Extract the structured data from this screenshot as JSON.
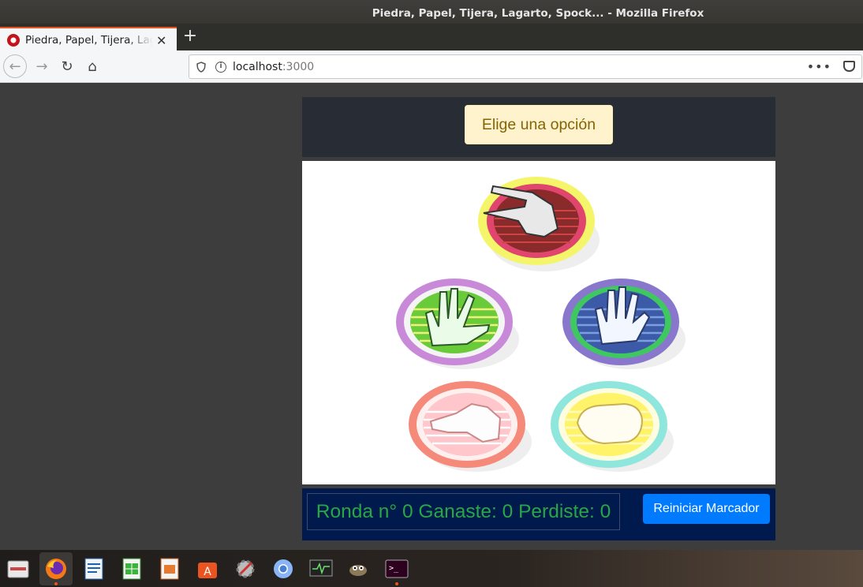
{
  "window": {
    "title": "Piedra, Papel, Tijera, Lagarto, Spock... - Mozilla Firefox"
  },
  "tab": {
    "title": "Piedra, Papel, Tijera, Lagarto, Spock...",
    "close": "✕",
    "new_tab": "+"
  },
  "navbar": {
    "back": "←",
    "forward": "→",
    "reload": "↻",
    "home": "⌂",
    "url_host": "localhost",
    "url_port": ":3000",
    "info_glyph": "i",
    "more_glyph": "•••"
  },
  "app": {
    "choose_label": "Elige una opción",
    "options": [
      "Tijera",
      "Spock",
      "Papel",
      "Lagarto",
      "Piedra"
    ],
    "score_text": "Ronda n° 0 Ganaste: 0 Perdiste: 0",
    "reset_label": "Reiniciar Marcador"
  },
  "taskbar": {
    "items": [
      "files-icon",
      "firefox-icon",
      "writer-icon",
      "calc-icon",
      "impress-icon",
      "software-icon",
      "settings-icon",
      "chromium-icon",
      "system-monitor-icon",
      "gimp-icon",
      "terminal-icon"
    ]
  },
  "colors": {
    "header_bg": "#282c34",
    "choose_bg": "#fff3cd",
    "choose_text": "#856404",
    "score_text": "#28a745",
    "footer_bg": "#001a4d",
    "reset_bg": "#007bff"
  }
}
